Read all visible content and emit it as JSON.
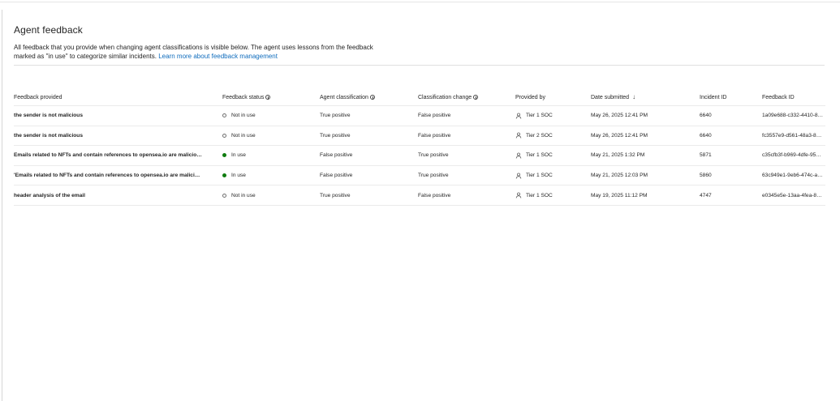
{
  "page": {
    "title": "Agent feedback",
    "description": "All feedback that you provide when changing agent classifications is visible below. The agent uses lessons from the feedback marked as \"in use\" to categorize similar incidents.",
    "learn_more_link": "Learn more about feedback management"
  },
  "table": {
    "columns": {
      "feedback": "Feedback provided",
      "status": "Feedback status",
      "agent_classification": "Agent classification",
      "classification_change": "Classification change",
      "provided_by": "Provided by",
      "date_submitted": "Date submitted",
      "incident_id": "Incident ID",
      "feedback_id": "Feedback ID"
    },
    "sort": {
      "column": "date_submitted",
      "direction": "descending",
      "icon": "arrow-down-icon"
    },
    "rows": [
      {
        "feedback": "the sender is not malicious",
        "status": "Not in use",
        "status_active": false,
        "agent_classification": "True positive",
        "classification_change": "False positive",
        "provided_by": "Tier 1 SOC",
        "date_submitted": "May 26, 2025 12:41 PM",
        "incident_id": "6640",
        "feedback_id": "1a09e688-c332-4410-8…"
      },
      {
        "feedback": "the sender is not malicious",
        "status": "Not in use",
        "status_active": false,
        "agent_classification": "True positive",
        "classification_change": "False positive",
        "provided_by": "Tier 2 SOC",
        "date_submitted": "May 26, 2025 12:41 PM",
        "incident_id": "6640",
        "feedback_id": "fc3557e9-d561-48a3-8…"
      },
      {
        "feedback": "Emails related to NFTs and contain references to opensea.io are malicio…",
        "status": "In use",
        "status_active": true,
        "agent_classification": "False positive",
        "classification_change": "True positive",
        "provided_by": "Tier 1 SOC",
        "date_submitted": "May 21, 2025 1:32 PM",
        "incident_id": "5871",
        "feedback_id": "c35cfb3f-b969-4dfe-95…"
      },
      {
        "feedback": "'Emails related to NFTs and contain references to opensea.io are malici…",
        "status": "In use",
        "status_active": true,
        "agent_classification": "False positive",
        "classification_change": "True positive",
        "provided_by": "Tier 1 SOC",
        "date_submitted": "May 21, 2025 12:03 PM",
        "incident_id": "5860",
        "feedback_id": "63c949e1-9eb6-474c-a…"
      },
      {
        "feedback": "header analysis of the email",
        "status": "Not in use",
        "status_active": false,
        "agent_classification": "True positive",
        "classification_change": "False positive",
        "provided_by": "Tier 1 SOC",
        "date_submitted": "May 19, 2025 11:12 PM",
        "incident_id": "4747",
        "feedback_id": "e0345e5e-13aa-4fea-8…"
      }
    ]
  },
  "colors": {
    "link": "#0f6cbd",
    "in_use": "#107c10",
    "not_in_use_ring": "#707070",
    "divider": "#e0e0e0"
  },
  "icons": {
    "info": "info-icon",
    "status_on": "status-in-use-icon",
    "status_off": "status-not-in-use-icon",
    "person": "person-icon"
  }
}
